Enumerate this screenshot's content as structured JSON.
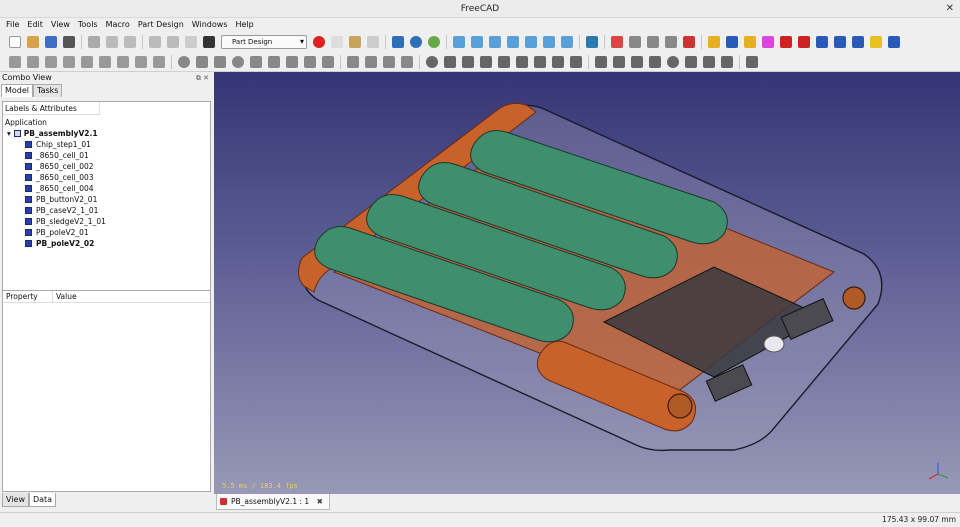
{
  "window": {
    "title": "FreeCAD"
  },
  "menu": [
    "File",
    "Edit",
    "View",
    "Tools",
    "Macro",
    "Part Design",
    "Windows",
    "Help"
  ],
  "toolbar": {
    "workbench": "Part Design"
  },
  "combo": {
    "title": "Combo View",
    "tabs": [
      "Model",
      "Tasks"
    ],
    "tree_header": "Labels & Attributes",
    "section": "Application",
    "root": "PB_assemblyV2.1",
    "items": [
      "Chip_step1_01",
      "_8650_cell_01",
      "_8650_cell_002",
      "_8650_cell_003",
      "_8650_cell_004",
      "PB_buttonV2_01",
      "PB_caseV2_1_01",
      "PB_sledgeV2_1_01",
      "PB_poleV2_01",
      "PB_poleV2_02"
    ],
    "prop_headers": [
      "Property",
      "Value"
    ],
    "bottom_tabs": [
      "View",
      "Data"
    ]
  },
  "viewport": {
    "fps": "5.5 ms / 183.4 fps"
  },
  "doc_tab": "PB_assemblyV2.1 : 1",
  "status": {
    "dimensions": "175.43 x 99.07 mm"
  },
  "colors": {
    "cell": "#3f8f6f",
    "case": "#c8622a",
    "accent": "#2a3fa8"
  }
}
